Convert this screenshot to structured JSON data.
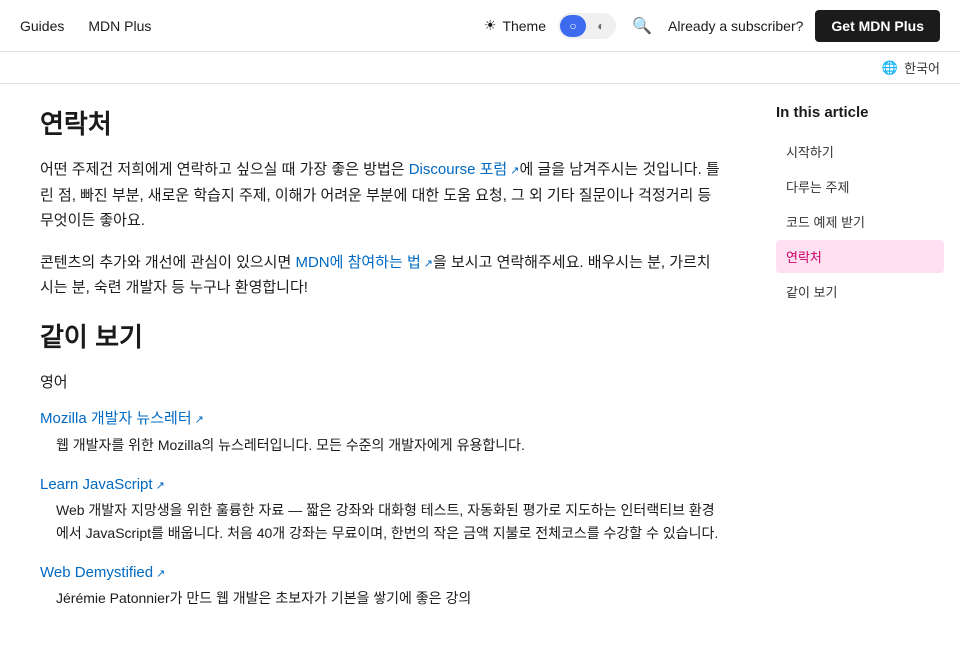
{
  "header": {
    "nav": [
      {
        "label": "Guides",
        "id": "guides"
      },
      {
        "label": "MDN Plus",
        "id": "mdn-plus"
      }
    ],
    "theme_label": "Theme",
    "theme_icon": "☀",
    "toggle_options": [
      {
        "label": "○",
        "active": true
      },
      {
        "label": "◐",
        "active": false
      }
    ],
    "search_placeholder": "Search",
    "subscriber_label": "Already a subscriber?",
    "mdn_plus_label": "Get MDN Plus"
  },
  "lang_bar": {
    "globe_icon": "🌐",
    "lang_label": "한국어"
  },
  "sidebar": {
    "title": "In this article",
    "items": [
      {
        "label": "시작하기",
        "id": "start",
        "active": false
      },
      {
        "label": "다루는 주제",
        "id": "topics",
        "active": false
      },
      {
        "label": "코드 예제 받기",
        "id": "code",
        "active": false
      },
      {
        "label": "연락처",
        "id": "contact",
        "active": true
      },
      {
        "label": "같이 보기",
        "id": "see-also",
        "active": false
      }
    ]
  },
  "content": {
    "contact_section": {
      "title": "연락처",
      "para1": "어떤 주제건 저희에게 연락하고 싶으실 때 가장 좋은 방법은 ",
      "link_text": "Discourse 포럼",
      "para1_after": "에 글을 남겨주시는 것입니다. 틀린 점, 빠진 부분, 새로운 학습지 주제, 이해가 어려운 부분에 대한 도움 요청, 그 외 기타 질문이나 걱정거리 등 무엇이든 좋아요.",
      "para2_before": "콘텐츠의 추가와 개선에 관심이 있으시면 ",
      "link2_text": "MDN에 참여하는 법",
      "para2_after": "을 보시고 연락해주세요. 배우시는 분, 가르치시는 분, 숙련 개발자 등 누구나 환영합니다!"
    },
    "see_also_section": {
      "title": "같이 보기",
      "lang_label": "영어",
      "resources": [
        {
          "link": "Mozilla 개발자 뉴스레터",
          "desc": "웹 개발자를 위한 Mozilla의 뉴스레터입니다. 모든 수준의 개발자에게 유용합니다."
        },
        {
          "link": "Learn JavaScript",
          "desc": "Web 개발자 지망생을 위한 훌륭한 자료 — 짧은 강좌와 대화형 테스트, 자동화된 평가로 지도하는 인터랙티브 환경에서 JavaScript를 배웁니다. 처음 40개 강좌는 무료이며, 한번의 작은 금액 지불로 전체코스를 수강할 수 있습니다."
        },
        {
          "link": "Web Demystified",
          "desc": "Jérémie Patonnier가 만드 웹 개발은 초보자가 기본을 쌓기에 좋은 강의"
        }
      ]
    }
  }
}
